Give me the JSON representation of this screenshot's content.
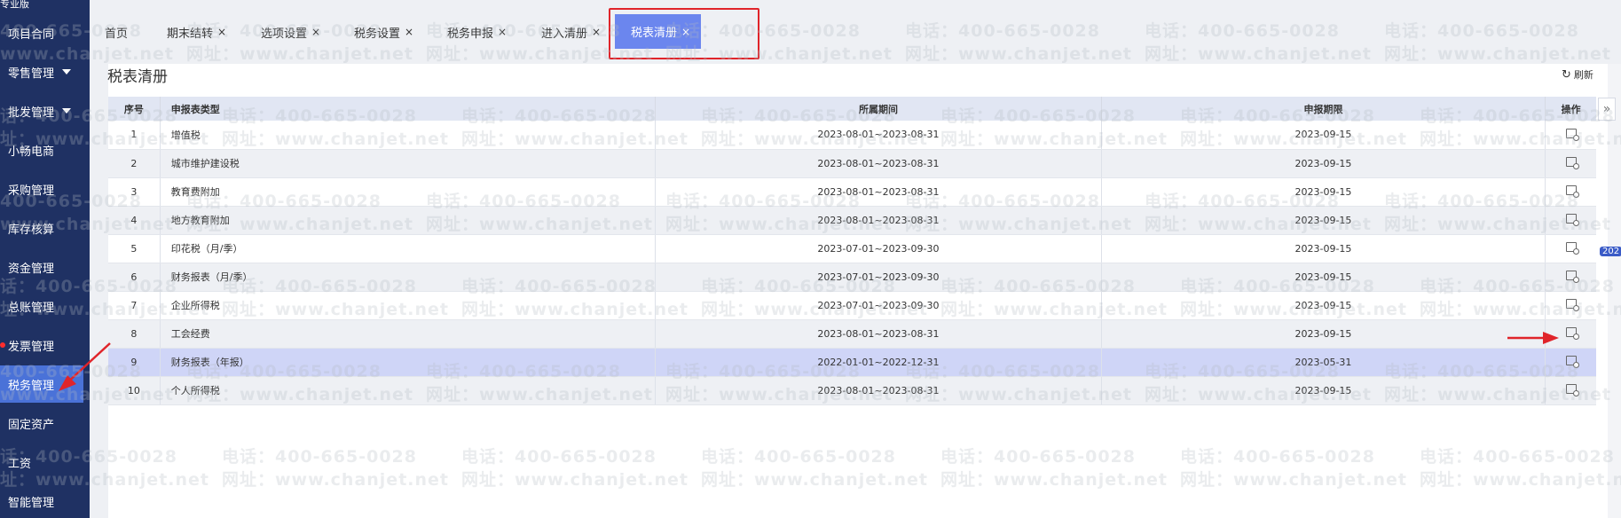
{
  "sidebar": {
    "edition": "专业版",
    "items": [
      {
        "label": "项目合同",
        "caret": false
      },
      {
        "label": "零售管理",
        "caret": true
      },
      {
        "label": "批发管理",
        "caret": true
      },
      {
        "label": "小畅电商",
        "caret": false
      },
      {
        "label": "采购管理",
        "caret": false
      },
      {
        "label": "库存核算",
        "caret": false
      },
      {
        "label": "资金管理",
        "caret": false
      },
      {
        "label": "总账管理",
        "caret": false
      },
      {
        "label": "发票管理",
        "caret": false
      },
      {
        "label": "税务管理",
        "caret": false
      },
      {
        "label": "固定资产",
        "caret": false
      },
      {
        "label": "工资",
        "caret": false
      },
      {
        "label": "智能管理",
        "caret": false
      }
    ],
    "active_index": 9,
    "active_color": "#4a72d8"
  },
  "tabs": [
    {
      "label": "首页",
      "closable": false
    },
    {
      "label": "期末结转",
      "closable": true
    },
    {
      "label": "选项设置",
      "closable": true
    },
    {
      "label": "税务设置",
      "closable": true
    },
    {
      "label": "税务申报",
      "closable": true
    },
    {
      "label": "进入清册",
      "closable": true
    },
    {
      "label": "税表清册",
      "closable": true
    }
  ],
  "active_tab_index": 6,
  "tab_close_glyph": "×",
  "page": {
    "title": "税表清册",
    "refresh_label": "刷新",
    "refresh_icon": "refresh-icon"
  },
  "table": {
    "headers": {
      "no": "序号",
      "type": "申报表类型",
      "period": "所属期间",
      "deadline": "申报期限",
      "op": "操作"
    },
    "rows": [
      {
        "no": "1",
        "type": "增值税",
        "period": "2023-08-01~2023-08-31",
        "deadline": "2023-09-15"
      },
      {
        "no": "2",
        "type": "城市维护建设税",
        "period": "2023-08-01~2023-08-31",
        "deadline": "2023-09-15"
      },
      {
        "no": "3",
        "type": "教育费附加",
        "period": "2023-08-01~2023-08-31",
        "deadline": "2023-09-15"
      },
      {
        "no": "4",
        "type": "地方教育附加",
        "period": "2023-08-01~2023-08-31",
        "deadline": "2023-09-15"
      },
      {
        "no": "5",
        "type": "印花税（月/季）",
        "period": "2023-07-01~2023-09-30",
        "deadline": "2023-09-15"
      },
      {
        "no": "6",
        "type": "财务报表（月/季）",
        "period": "2023-07-01~2023-09-30",
        "deadline": "2023-09-15"
      },
      {
        "no": "7",
        "type": "企业所得税",
        "period": "2023-07-01~2023-09-30",
        "deadline": "2023-09-15"
      },
      {
        "no": "8",
        "type": "工会经费",
        "period": "2023-08-01~2023-08-31",
        "deadline": "2023-09-15"
      },
      {
        "no": "9",
        "type": "财务报表（年报）",
        "period": "2022-01-01~2022-12-31",
        "deadline": "2023-05-31"
      },
      {
        "no": "10",
        "type": "个人所得税",
        "period": "2023-08-01~2023-08-31",
        "deadline": "2023-09-15"
      }
    ],
    "selected_row_index": 8,
    "op_icon": "view-report-icon"
  },
  "right_edge": {
    "expand_glyph": "»",
    "badge": "202"
  },
  "watermark": {
    "phone": "电话：400-665-0028",
    "site": "网址：www.chanjet.net"
  },
  "colors": {
    "sidebar_bg": "#1f3163",
    "active_tab": "#6b86ee",
    "selected_row": "#cfd5f7",
    "annotation_red": "#e0242a"
  }
}
